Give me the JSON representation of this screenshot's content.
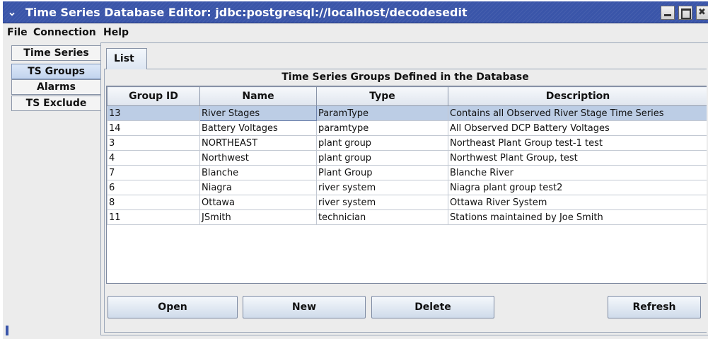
{
  "window": {
    "title": "Time Series Database Editor: jdbc:postgresql://localhost/decodesedit",
    "menu_icon": "chevron-down-icon"
  },
  "menubar": {
    "items": [
      "File",
      "Connection",
      "Help"
    ]
  },
  "left_tabs": [
    {
      "label": "Time Series"
    },
    {
      "label": "TS Groups"
    },
    {
      "label": "Alarms"
    },
    {
      "label": "TS Exclude"
    }
  ],
  "selected_left_tab": "TS Groups",
  "content_tab": {
    "label": "List"
  },
  "table": {
    "title": "Time Series Groups Defined in the Database",
    "columns": [
      "Group ID",
      "Name",
      "Type",
      "Description"
    ],
    "rows": [
      {
        "id": "13",
        "name": "River Stages",
        "type": "ParamType",
        "description": "Contains all Observed River Stage Time Series"
      },
      {
        "id": "14",
        "name": "Battery Voltages",
        "type": "paramtype",
        "description": "All Observed DCP Battery Voltages"
      },
      {
        "id": "3",
        "name": "NORTHEAST",
        "type": "plant group",
        "description": "Northeast Plant Group test-1 test"
      },
      {
        "id": "4",
        "name": "Northwest",
        "type": "plant group",
        "description": "Northwest Plant Group, test"
      },
      {
        "id": "7",
        "name": "Blanche",
        "type": "Plant Group",
        "description": "Blanche River"
      },
      {
        "id": "6",
        "name": "Niagra",
        "type": "river system",
        "description": "Niagra plant group test2"
      },
      {
        "id": "8",
        "name": "Ottawa",
        "type": "river system",
        "description": "Ottawa River System"
      },
      {
        "id": "11",
        "name": "JSmith",
        "type": "technician",
        "description": "Stations maintained by Joe Smith"
      }
    ],
    "selected_row": 0
  },
  "buttons": {
    "open": "Open",
    "new": "New",
    "delete": "Delete",
    "refresh": "Refresh"
  },
  "colors": {
    "titlebar": "#3a55a9",
    "selection": "#bccde5",
    "selected_tab": "#c2d4ee"
  }
}
